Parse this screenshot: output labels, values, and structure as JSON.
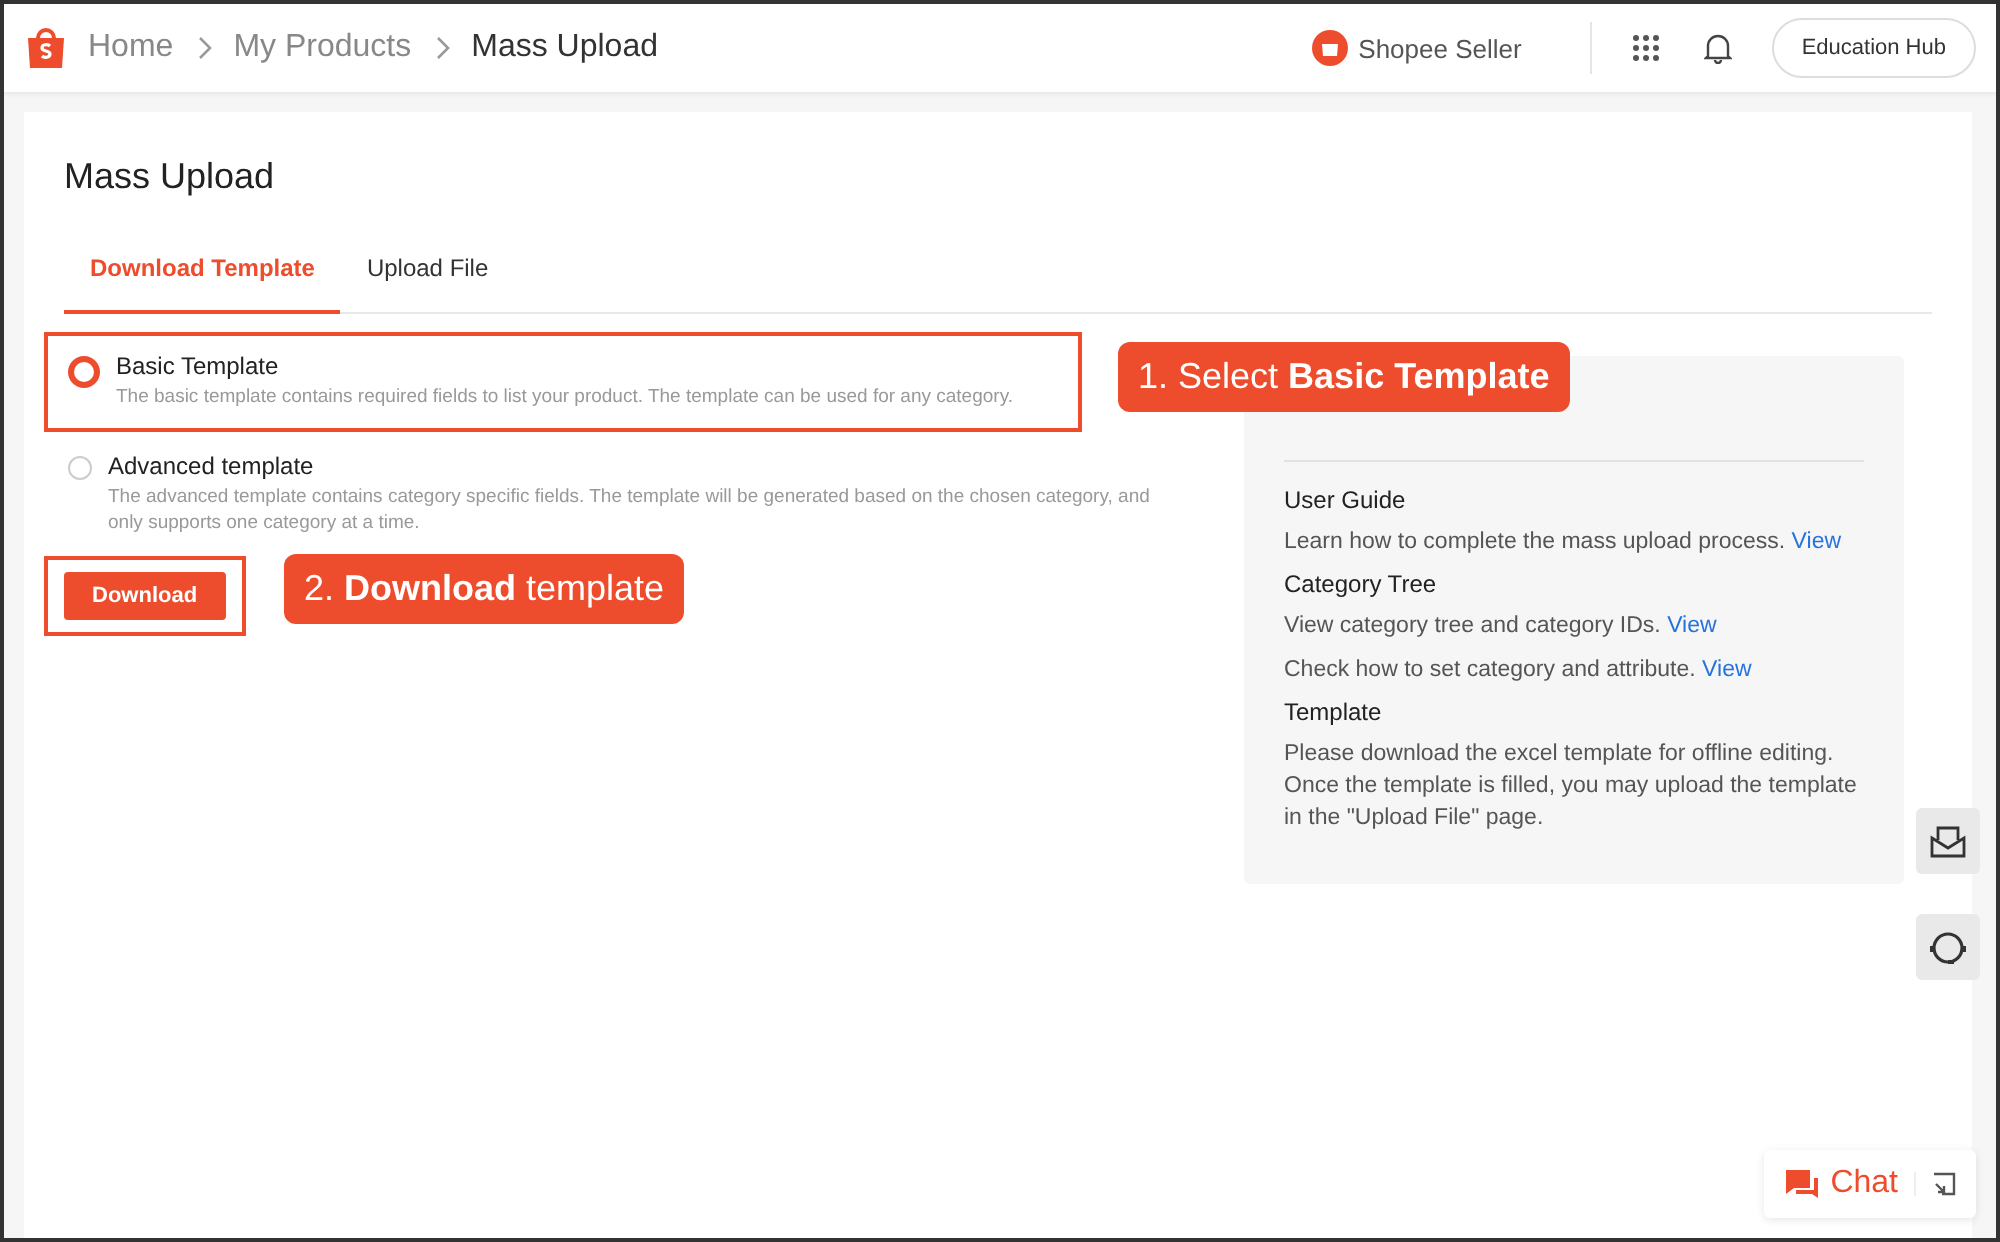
{
  "breadcrumb": [
    {
      "label": "Home"
    },
    {
      "label": "My Products"
    },
    {
      "label": "Mass Upload"
    }
  ],
  "header": {
    "brand": "Shopee Seller",
    "button": "Education Hub"
  },
  "page_title": "Mass Upload",
  "tabs": [
    {
      "label": "Download Template",
      "selected": true
    },
    {
      "label": "Upload File",
      "selected": false
    }
  ],
  "options": [
    {
      "label": "Basic Template",
      "description": "The basic template contains required fields to list your product. The template can be used for any category.",
      "selected": true,
      "highlighted": true
    },
    {
      "label": "Advanced template",
      "description": "The advanced template contains category specific fields. The template will be generated based on the chosen category, and only supports one category at a time.",
      "selected": false,
      "highlighted": false
    }
  ],
  "download_button": {
    "label": "Download",
    "highlighted": true
  },
  "tips": [
    {
      "heading": "User Guide",
      "lines": [
        {
          "text": "Learn how to complete the mass upload process.",
          "link": "View"
        }
      ]
    },
    {
      "heading": "Category Tree",
      "lines": [
        {
          "text": "View category tree and category IDs.",
          "link": "View"
        },
        {
          "text": "Check how to set category and attribute.",
          "link": "View"
        }
      ]
    },
    {
      "heading": "Template",
      "lines": [
        {
          "text": "Please download the excel template for offline editing. Once the template is filled, you may upload the template in the \"Upload File\" page."
        }
      ]
    }
  ],
  "callouts": [
    {
      "text": "1. Select **Basic Template**"
    },
    {
      "text": "2. **Download** template"
    }
  ],
  "chat": {
    "label": "Chat"
  }
}
